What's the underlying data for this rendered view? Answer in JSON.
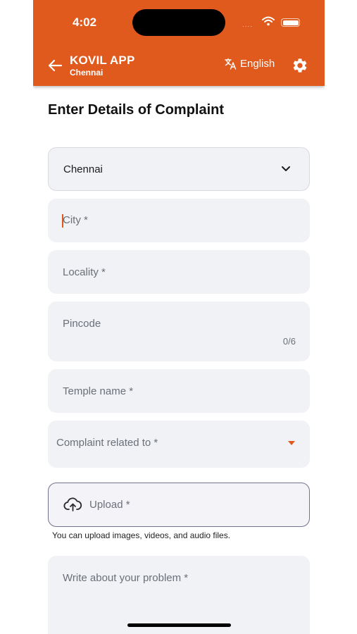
{
  "status": {
    "time": "4:02",
    "signal_dots": "....",
    "colors": {
      "accent": "#e05a1e"
    }
  },
  "header": {
    "back_icon": "arrow-left-icon",
    "title": "KOVIL APP",
    "subtitle": "Chennai",
    "language_label": "English",
    "translate_icon": "translate-icon",
    "settings_icon": "gear-icon"
  },
  "form": {
    "page_title": "Enter Details of Complaint",
    "district_value": "Chennai",
    "city_placeholder": "City *",
    "locality_placeholder": "Locality *",
    "pincode_placeholder": "Pincode",
    "pincode_counter": "0/6",
    "temple_placeholder": "Temple name *",
    "complaint_placeholder": "Complaint related to *",
    "upload_label": "Upload *",
    "upload_hint": "You can upload images, videos, and audio files.",
    "problem_placeholder": "Write about your problem *"
  }
}
